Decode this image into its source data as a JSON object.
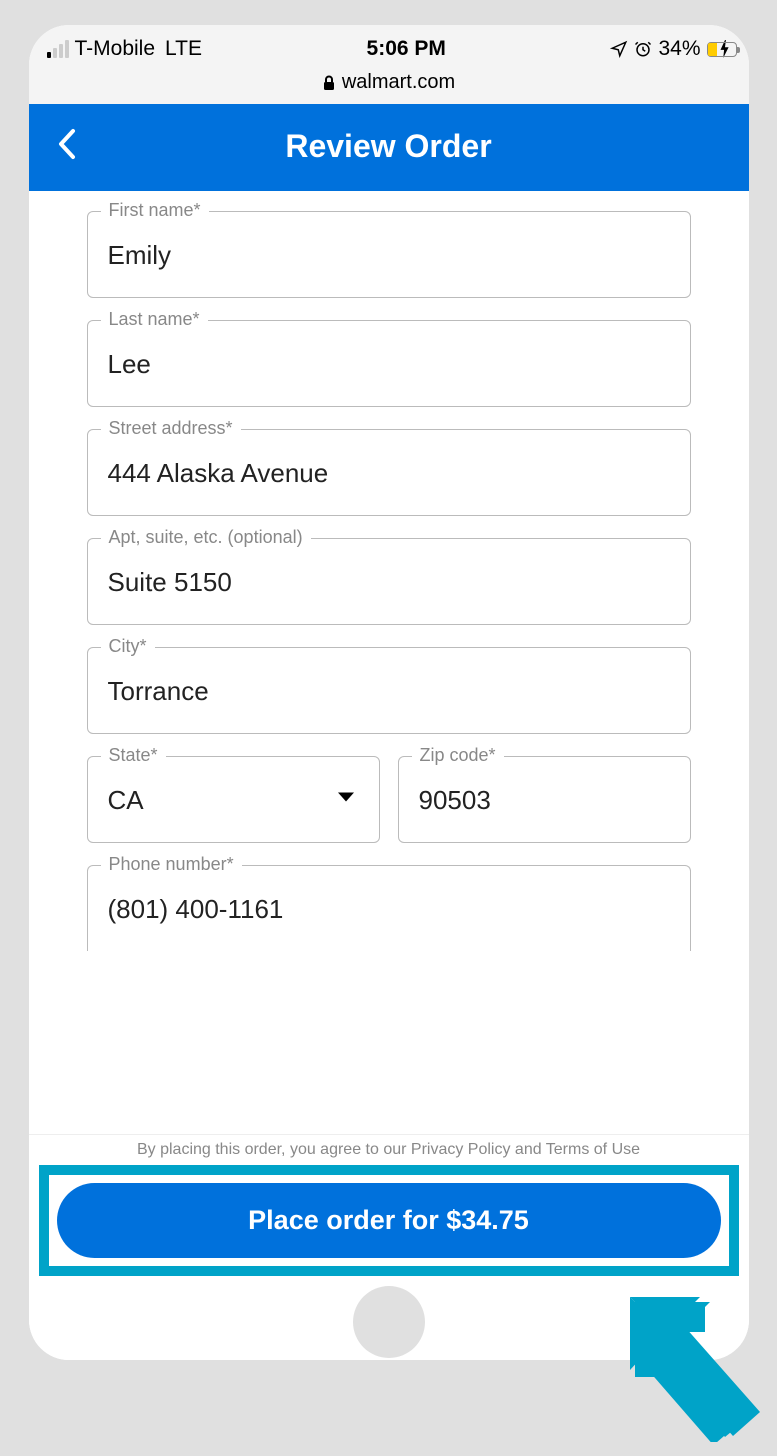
{
  "status": {
    "carrier": "T-Mobile",
    "network": "LTE",
    "time": "5:06 PM",
    "battery_percent": "34%"
  },
  "url_bar": {
    "domain": "walmart.com"
  },
  "header": {
    "title": "Review Order"
  },
  "form": {
    "first_name": {
      "label": "First name*",
      "value": "Emily"
    },
    "last_name": {
      "label": "Last name*",
      "value": "Lee"
    },
    "street": {
      "label": "Street address*",
      "value": "444 Alaska Avenue"
    },
    "apt": {
      "label": "Apt, suite, etc. (optional)",
      "value": "Suite 5150"
    },
    "city": {
      "label": "City*",
      "value": "Torrance"
    },
    "state": {
      "label": "State*",
      "value": "CA"
    },
    "zip": {
      "label": "Zip code*",
      "value": "90503"
    },
    "phone": {
      "label": "Phone number*",
      "value": "(801) 400-1161"
    }
  },
  "footer": {
    "disclaimer": "By placing this order, you agree to our Privacy Policy and Terms of Use",
    "button_label": "Place order for $34.75"
  }
}
